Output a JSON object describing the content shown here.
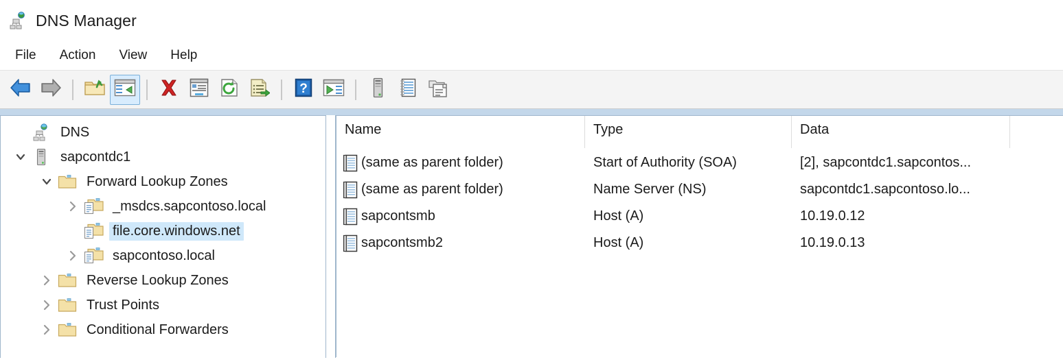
{
  "window": {
    "title": "DNS Manager",
    "app_icon": "dns-server-icon"
  },
  "menu": {
    "items": [
      {
        "label": "File",
        "name": "menu-file"
      },
      {
        "label": "Action",
        "name": "menu-action"
      },
      {
        "label": "View",
        "name": "menu-view"
      },
      {
        "label": "Help",
        "name": "menu-help"
      }
    ]
  },
  "toolbar": {
    "buttons": [
      {
        "icon": "back-arrow-icon",
        "name": "toolbar-back",
        "active": false
      },
      {
        "icon": "forward-arrow-icon",
        "name": "toolbar-forward",
        "active": false
      },
      {
        "separator": true
      },
      {
        "icon": "up-folder-icon",
        "name": "toolbar-up-one-level",
        "active": false
      },
      {
        "icon": "show-console-tree-icon",
        "name": "toolbar-show-hide-console-tree",
        "active": true
      },
      {
        "separator": true
      },
      {
        "icon": "delete-x-icon",
        "name": "toolbar-delete",
        "active": false
      },
      {
        "icon": "properties-icon",
        "name": "toolbar-properties",
        "active": false
      },
      {
        "icon": "refresh-icon",
        "name": "toolbar-refresh",
        "active": false
      },
      {
        "icon": "export-list-icon",
        "name": "toolbar-export-list",
        "active": false
      },
      {
        "separator": true
      },
      {
        "icon": "help-question-icon",
        "name": "toolbar-help",
        "active": false
      },
      {
        "icon": "run-console-icon",
        "name": "toolbar-show-console",
        "active": false
      },
      {
        "separator": true
      },
      {
        "icon": "server-icon",
        "name": "toolbar-new-server",
        "active": false
      },
      {
        "icon": "record-list-icon",
        "name": "toolbar-new-zone",
        "active": false
      },
      {
        "icon": "copy-zone-icon",
        "name": "toolbar-copy",
        "active": false
      }
    ]
  },
  "tree": {
    "nodes": [
      {
        "label": "DNS",
        "icon": "dns-root-icon",
        "indent": 0,
        "twist": "none",
        "selected": false
      },
      {
        "label": "sapcontdc1",
        "icon": "server-icon",
        "indent": 1,
        "twist": "expanded",
        "selected": false
      },
      {
        "label": "Forward Lookup Zones",
        "icon": "folder-icon",
        "indent": 2,
        "twist": "expanded",
        "selected": false
      },
      {
        "label": "_msdcs.sapcontoso.local",
        "icon": "zone-icon",
        "indent": 3,
        "twist": "collapsed",
        "selected": false
      },
      {
        "label": "file.core.windows.net",
        "icon": "zone-icon",
        "indent": 3,
        "twist": "none",
        "selected": true
      },
      {
        "label": "sapcontoso.local",
        "icon": "zone-icon",
        "indent": 3,
        "twist": "collapsed",
        "selected": false
      },
      {
        "label": "Reverse Lookup Zones",
        "icon": "folder-icon",
        "indent": 2,
        "twist": "collapsed",
        "selected": false
      },
      {
        "label": "Trust Points",
        "icon": "folder-icon",
        "indent": 2,
        "twist": "collapsed",
        "selected": false
      },
      {
        "label": "Conditional Forwarders",
        "icon": "folder-icon",
        "indent": 2,
        "twist": "collapsed",
        "selected": false
      }
    ]
  },
  "list": {
    "columns": [
      {
        "label": "Name",
        "name": "column-header-name"
      },
      {
        "label": "Type",
        "name": "column-header-type"
      },
      {
        "label": "Data",
        "name": "column-header-data"
      }
    ],
    "rows": [
      {
        "name": "(same as parent folder)",
        "type": "Start of Authority (SOA)",
        "data": "[2], sapcontdc1.sapcontos...",
        "icon": "dns-record-icon"
      },
      {
        "name": "(same as parent folder)",
        "type": "Name Server (NS)",
        "data": "sapcontdc1.sapcontoso.lo...",
        "icon": "dns-record-icon"
      },
      {
        "name": "sapcontsmb",
        "type": "Host (A)",
        "data": "10.19.0.12",
        "icon": "dns-record-icon"
      },
      {
        "name": "sapcontsmb2",
        "type": "Host (A)",
        "data": "10.19.0.13",
        "icon": "dns-record-icon"
      }
    ]
  },
  "colors": {
    "selection": "#cfe8fa",
    "toolbar_active": "#d8ecfd",
    "band": "#c3d7ea",
    "pane_border": "#9fb6cc"
  }
}
